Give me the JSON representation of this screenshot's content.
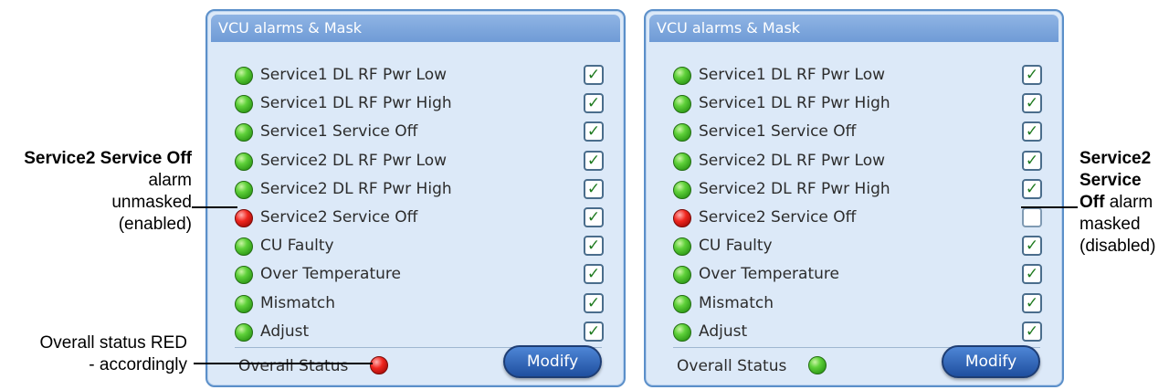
{
  "panels": [
    {
      "title": "VCU alarms & Mask",
      "overall_label": "Overall Status",
      "modify_label": "Modify",
      "overall_status": "red",
      "alarms": [
        {
          "label": "Service1 DL RF Pwr Low",
          "status": "green",
          "masked": false
        },
        {
          "label": "Service1 DL RF Pwr High",
          "status": "green",
          "masked": false
        },
        {
          "label": "Service1 Service Off",
          "status": "green",
          "masked": false
        },
        {
          "label": "Service2 DL RF Pwr Low",
          "status": "green",
          "masked": false
        },
        {
          "label": "Service2 DL RF Pwr High",
          "status": "green",
          "masked": false
        },
        {
          "label": "Service2 Service Off",
          "status": "red",
          "masked": false
        },
        {
          "label": "CU Faulty",
          "status": "green",
          "masked": false
        },
        {
          "label": "Over Temperature",
          "status": "green",
          "masked": false
        },
        {
          "label": "Mismatch",
          "status": "green",
          "masked": false
        },
        {
          "label": "Adjust",
          "status": "green",
          "masked": false
        }
      ]
    },
    {
      "title": "VCU alarms & Mask",
      "overall_label": "Overall Status",
      "modify_label": "Modify",
      "overall_status": "green",
      "alarms": [
        {
          "label": "Service1 DL RF Pwr Low",
          "status": "green",
          "masked": false
        },
        {
          "label": "Service1 DL RF Pwr High",
          "status": "green",
          "masked": false
        },
        {
          "label": "Service1 Service Off",
          "status": "green",
          "masked": false
        },
        {
          "label": "Service2 DL RF Pwr Low",
          "status": "green",
          "masked": false
        },
        {
          "label": "Service2 DL RF Pwr High",
          "status": "green",
          "masked": false
        },
        {
          "label": "Service2 Service Off",
          "status": "red",
          "masked": true
        },
        {
          "label": "CU Faulty",
          "status": "green",
          "masked": false
        },
        {
          "label": "Over Temperature",
          "status": "green",
          "masked": false
        },
        {
          "label": "Mismatch",
          "status": "green",
          "masked": false
        },
        {
          "label": "Adjust",
          "status": "green",
          "masked": false
        }
      ]
    }
  ],
  "checkmark_glyph": "✓",
  "annotations": {
    "left_top": {
      "bold": "Service2 Service Off",
      "text_line2": " alarm",
      "line3": "unmasked",
      "line4": "(enabled)"
    },
    "left_bottom": {
      "line1": "Overall status RED",
      "line2": "- accordingly"
    },
    "right": {
      "bold": "Service2 Service Off",
      "text": " alarm",
      "line4": "masked",
      "line5": "(disabled)"
    }
  },
  "colors": {
    "panel_border": "#5b8fc9",
    "panel_bg": "#dce9f8",
    "header": "#7fa8de",
    "led_green": "#3fb820",
    "led_red": "#e01f18",
    "modify_button": "#2a5ca8"
  }
}
